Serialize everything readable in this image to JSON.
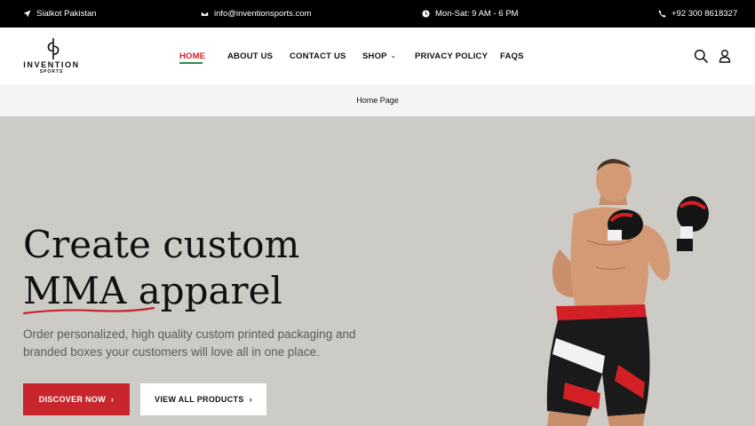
{
  "topbar": {
    "location": "Sialkot Pakistan",
    "email": "info@inventionsports.com",
    "hours": "Mon-Sat: 9 AM - 6 PM",
    "phone": "+92 300 8618327"
  },
  "logo": {
    "word": "INVENTION",
    "sub": "SPORTS"
  },
  "nav": {
    "items": [
      {
        "label": "HOME",
        "active": true
      },
      {
        "label": "ABOUT US"
      },
      {
        "label": "CONTACT US"
      },
      {
        "label": "SHOP"
      },
      {
        "label": "PRIVACY POLICY"
      },
      {
        "label": "FAQS"
      }
    ]
  },
  "breadcrumb": "Home Page",
  "hero": {
    "title_line1": "Create custom",
    "title_highlight": "MMA",
    "title_line2_rest": "apparel",
    "description": "Order personalized, high quality custom printed packaging and branded boxes your customers will love all in one place.",
    "primary_button": "DISCOVER NOW",
    "secondary_button": "VIEW ALL PRODUCTS"
  },
  "colors": {
    "accent": "#c8252c",
    "nav_active": "#d32027",
    "hero_bg": "#cdcbc6",
    "topbar_bg": "#000000"
  },
  "icons": [
    "location-arrow-icon",
    "mail-icon",
    "clock-icon",
    "phone-icon",
    "search-icon",
    "user-icon",
    "chevron-right-icon"
  ]
}
